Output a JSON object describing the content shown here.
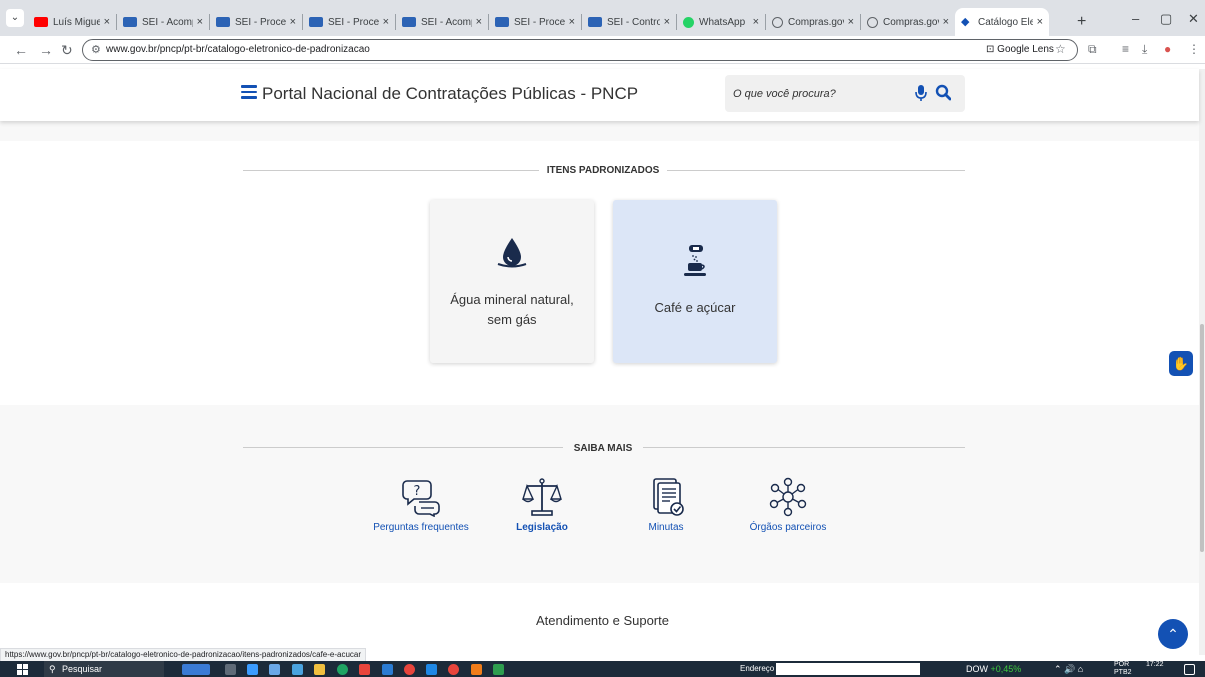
{
  "browser": {
    "tabs": [
      {
        "title": "Luís Miguel Co",
        "favicon": "youtube-icon",
        "active": false
      },
      {
        "title": "SEI - Acompan",
        "favicon": "sei-icon",
        "active": false
      },
      {
        "title": "SEI - Processo",
        "favicon": "sei-icon",
        "active": false
      },
      {
        "title": "SEI - Processo",
        "favicon": "sei-icon",
        "active": false
      },
      {
        "title": "SEI - Acompan",
        "favicon": "sei-icon",
        "active": false
      },
      {
        "title": "SEI - Processo",
        "favicon": "sei-icon",
        "active": false
      },
      {
        "title": "SEI - Controle",
        "favicon": "sei-icon",
        "active": false
      },
      {
        "title": "WhatsApp",
        "favicon": "whatsapp-icon",
        "active": false
      },
      {
        "title": "Compras.gov.b",
        "favicon": "gov-icon",
        "active": false
      },
      {
        "title": "Compras.gov.b",
        "favicon": "gov-icon",
        "active": false
      },
      {
        "title": "Catálogo Eletr",
        "favicon": "pncp-icon",
        "active": true
      }
    ],
    "tab_close": "×",
    "new_tab": "+",
    "url": "www.gov.br/pncp/pt-br/catalogo-eletronico-de-padronizacao",
    "google_lens": "Google Lens",
    "status_url": "https://www.gov.br/pncp/pt-br/catalogo-eletronico-de-padronizacao/itens-padronizados/cafe-e-acucar"
  },
  "header": {
    "title": "Portal Nacional de Contratações Públicas - PNCP",
    "search_placeholder": "O que você procura?"
  },
  "padronizados": {
    "heading": "ITENS PADRONIZADOS",
    "cards": [
      {
        "label_line1": "Água mineral natural,",
        "label_line2": "sem gás",
        "icon": "water-drop-icon"
      },
      {
        "label": "Café e açúcar",
        "icon": "coffee-sugar-icon"
      }
    ]
  },
  "saiba_mais": {
    "heading": "SAIBA MAIS",
    "items": [
      {
        "label": "Perguntas frequentes",
        "icon": "faq-icon"
      },
      {
        "label": "Legislação",
        "icon": "scales-icon"
      },
      {
        "label": "Minutas",
        "icon": "document-check-icon"
      },
      {
        "label": "Órgãos parceiros",
        "icon": "network-icon"
      }
    ]
  },
  "support": {
    "title": "Atendimento e Suporte"
  },
  "taskbar": {
    "search": "Pesquisar",
    "address_label": "Endereço",
    "ticker_name": "DOW",
    "ticker_change": "+0,45%",
    "lang": "POR",
    "lang_sub": "PTB2",
    "time": "17:22"
  },
  "colors": {
    "primary": "#1351b4",
    "selected_card": "#dce6f7",
    "card_bg": "#f5f5f5"
  }
}
